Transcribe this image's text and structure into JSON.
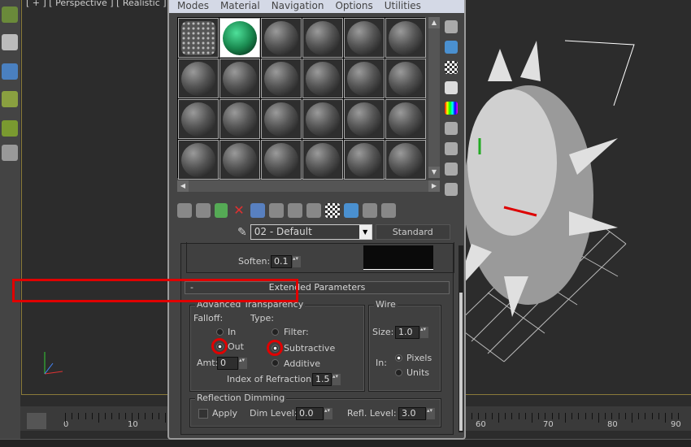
{
  "viewport": {
    "label": "[ + ] [ Perspective ] [ Realistic ]"
  },
  "timeline": {
    "ticks": [
      "0",
      "10",
      "60",
      "70",
      "80",
      "90"
    ]
  },
  "menu": [
    "Modes",
    "Material",
    "Navigation",
    "Options",
    "Utilities"
  ],
  "material": {
    "name": "02 - Default",
    "type": "Standard"
  },
  "shader": {
    "soften_label": "Soften:",
    "soften": "0.1"
  },
  "rollout": {
    "title": "Extended Parameters",
    "collapse": "-"
  },
  "adv": {
    "title": "Advanced Transparency",
    "falloff": "Falloff:",
    "type": "Type:",
    "in": "In",
    "out": "Out",
    "filter": "Filter:",
    "subtractive": "Subtractive",
    "additive": "Additive",
    "amt_label": "Amt:",
    "amt": "0",
    "ior_label": "Index of Refraction:",
    "ior": "1.5",
    "falloff_selected": "Out",
    "type_selected": "Subtractive"
  },
  "wire": {
    "title": "Wire",
    "size_label": "Size:",
    "size": "1.0",
    "in_label": "In:",
    "pixels": "Pixels",
    "units": "Units",
    "selected": "Pixels"
  },
  "refl": {
    "title": "Reflection Dimming",
    "apply": "Apply",
    "apply_checked": false,
    "dim_label": "Dim Level:",
    "dim": "0.0",
    "refl_label": "Refl. Level:",
    "refl": "3.0"
  },
  "colors": {
    "highlight": "#e00000",
    "active_tool": "#4a90d0"
  }
}
